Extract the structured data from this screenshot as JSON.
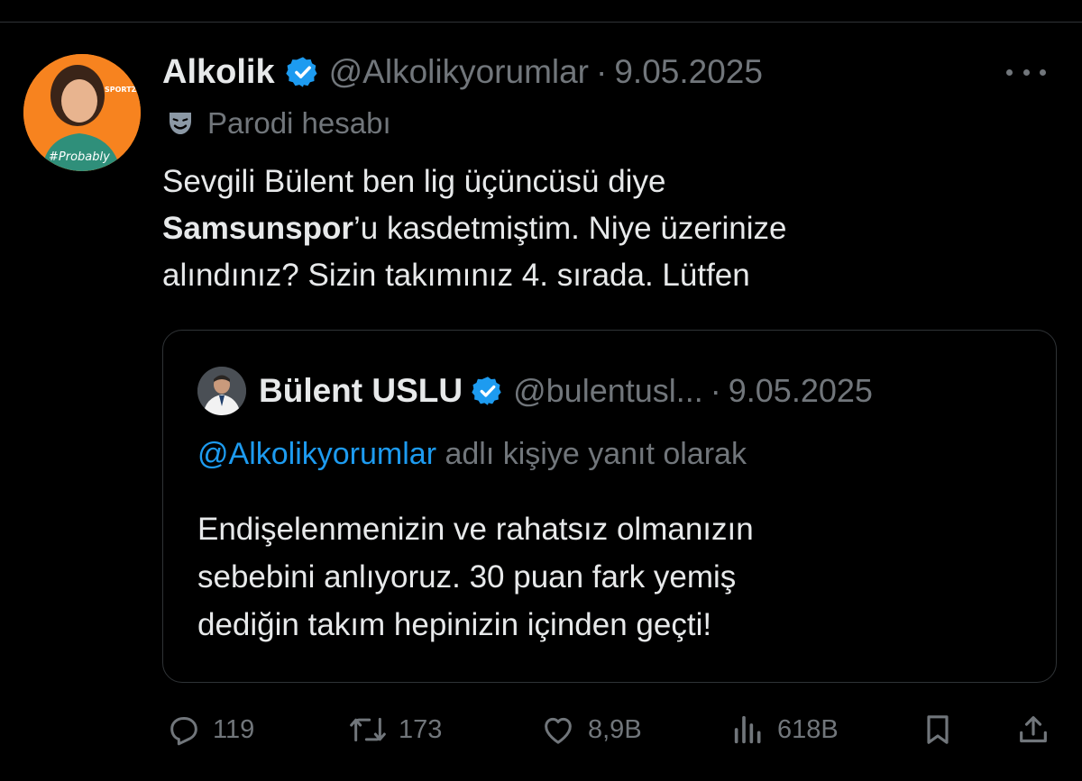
{
  "tweet": {
    "display_name": "Alkolik",
    "handle": "@Alkolikyorumlar",
    "separator": "·",
    "date": "9.05.2025",
    "parody_label": "Parodi hesabı",
    "text_line1": "Sevgili Bülent ben lig üçüncüsü diye",
    "text_bold": "Samsunspor",
    "text_line2_rest": "’u kasdetmiştim. Niye üzerinize",
    "text_line3": "alındınız? Sizin takımınız 4. sırada. Lütfen",
    "avatar_text": "#Probably",
    "avatar_badge": "SPORTZ"
  },
  "quote": {
    "display_name": "Bülent USLU",
    "handle": "@bulentusl...",
    "separator": "·",
    "date": "9.05.2025",
    "reply_mention": "@Alkolikyorumlar",
    "reply_suffix": " adlı kişiye yanıt olarak",
    "text_line1": "Endişelenmenizin ve rahatsız olmanızın",
    "text_line2": "sebebini anlıyoruz. 30 puan fark yemiş",
    "text_line3": "dediğin takım hepinizin içinden geçti!"
  },
  "actions": {
    "replies": "119",
    "reposts": "173",
    "likes": "8,9B",
    "views": "618B"
  },
  "colors": {
    "background": "#000000",
    "text": "#e7e9ea",
    "muted": "#71767b",
    "accent": "#1d9bf0",
    "border": "#2f3336"
  },
  "icons": [
    "verified-badge-icon",
    "parody-mask-icon",
    "more-icon",
    "reply-icon",
    "repost-icon",
    "like-icon",
    "views-icon",
    "bookmark-icon",
    "share-icon"
  ]
}
